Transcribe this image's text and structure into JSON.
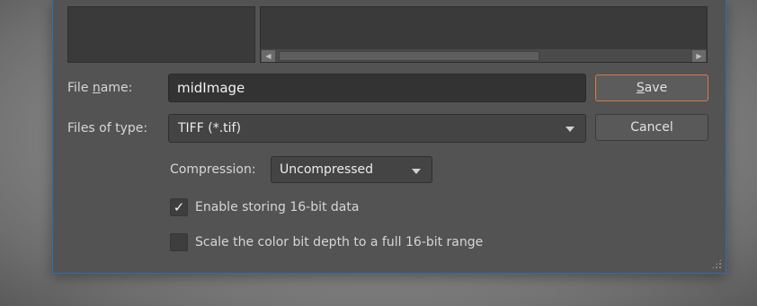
{
  "filename": {
    "label_pre": "File ",
    "label_mnemonic": "n",
    "label_post": "ame:",
    "value": "midImage"
  },
  "filetype": {
    "label": "Files of type:",
    "selected": "TIFF (*.tif)"
  },
  "buttons": {
    "save_mnemonic": "S",
    "save_rest": "ave",
    "cancel": "Cancel"
  },
  "compression": {
    "label": "Compression:",
    "selected": "Uncompressed"
  },
  "options": {
    "enable_16bit_label": "Enable storing 16-bit data",
    "enable_16bit_checked": true,
    "enable_16bit_mark": "✓",
    "scale_depth_label": "Scale the color bit depth to a full 16-bit range",
    "scale_depth_checked": false
  },
  "colors": {
    "dialog_bg": "#535353",
    "accent_border": "#2d6fb6",
    "default_button_border": "#c97d52"
  }
}
